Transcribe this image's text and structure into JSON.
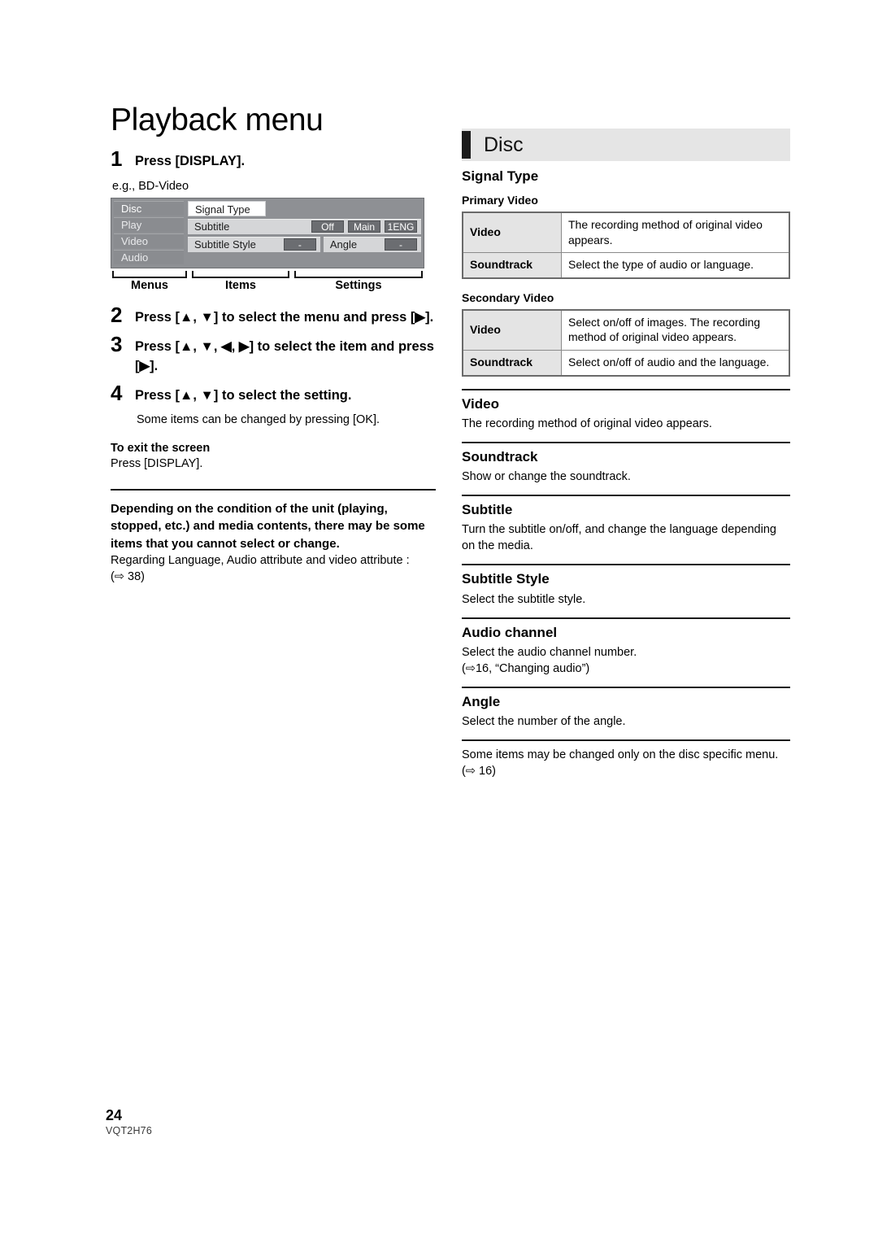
{
  "left": {
    "page_title": "Playback menu",
    "steps": [
      {
        "num": "1",
        "text": "Press [DISPLAY]."
      },
      {
        "num": "2",
        "text": "Press [▲, ▼] to select the menu and press [▶]."
      },
      {
        "num": "3",
        "text": "Press [▲, ▼, ◀, ▶] to select the item and press [▶]."
      },
      {
        "num": "4",
        "text": "Press [▲, ▼] to select the setting."
      }
    ],
    "step4_note": "Some items can be changed by pressing [OK].",
    "exit_heading": "To exit the screen",
    "exit_body": "Press [DISPLAY].",
    "note_bold": "Depending on the condition of the unit (playing, stopped, etc.) and media contents, there may be some items that you cannot select or change.",
    "note_plain_1": "Regarding Language, Audio attribute and video attribute :",
    "note_plain_2": "(⇨ 38)"
  },
  "diagram": {
    "caption": "e.g., BD-Video",
    "menus": [
      "Disc",
      "Play",
      "Video",
      "Audio"
    ],
    "selected_menu": "Disc",
    "rows": [
      {
        "label": "Signal Type",
        "style": "white-chip",
        "buttons": []
      },
      {
        "label": "Subtitle",
        "style": "bar",
        "buttons": [
          "Off",
          "Main",
          "1ENG"
        ]
      },
      {
        "label": "Subtitle Style",
        "style": "bar-split",
        "buttons": [
          "-"
        ],
        "second_label": "Angle",
        "second_buttons": [
          "-"
        ]
      }
    ],
    "bracket_labels": [
      "Menus",
      "Items",
      "Settings"
    ]
  },
  "right": {
    "header_title": "Disc",
    "signal_type_heading": "Signal Type",
    "tables": [
      {
        "caption": "Primary Video",
        "rows": [
          {
            "key": "Video",
            "value": "The recording method of original video appears."
          },
          {
            "key": "Soundtrack",
            "value": "Select the type of audio or language."
          }
        ]
      },
      {
        "caption": "Secondary Video",
        "rows": [
          {
            "key": "Video",
            "value": "Select on/off of images. The recording method of original video appears."
          },
          {
            "key": "Soundtrack",
            "value": "Select on/off of audio and the language."
          }
        ]
      }
    ],
    "sections": [
      {
        "heading": "Video",
        "body": "The recording method of original video appears."
      },
      {
        "heading": "Soundtrack",
        "body": "Show or change the soundtrack."
      },
      {
        "heading": "Subtitle",
        "body": "Turn the subtitle on/off, and change the language depending on the media."
      },
      {
        "heading": "Subtitle Style",
        "body": "Select the subtitle style."
      },
      {
        "heading": "Audio channel",
        "body": "Select the audio channel number.\n(⇨16, “Changing audio”)"
      },
      {
        "heading": "Angle",
        "body": "Select the number of the angle."
      }
    ],
    "footer_note": "Some items may be changed only on the disc specific menu.\n(⇨ 16)"
  },
  "footer": {
    "page_number": "24",
    "doc_code": "VQT2H76"
  },
  "colors": {
    "header_band": "#e5e5e5",
    "header_bar": "#1c1c1c",
    "table_key_bg": "#e4e4e4",
    "osd_bg": "#8e9094",
    "osd_item_bg": "#d5d6d8",
    "osd_button_bg": "#6b6d71"
  }
}
